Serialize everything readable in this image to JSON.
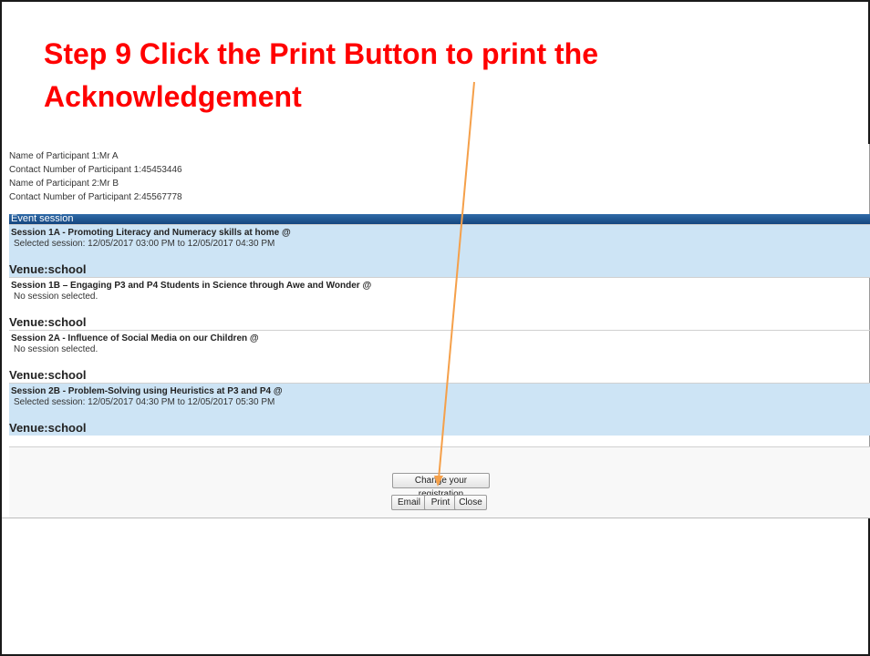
{
  "slide": {
    "title_line1": "Step 9 Click the Print Button to print the",
    "title_line2": "Acknowledgement"
  },
  "participants": [
    "Name of Participant 1:Mr A",
    "Contact Number of Participant 1:45453446",
    "Name of Participant 2:Mr B",
    "Contact Number of Participant 2:45567778"
  ],
  "event_session_header": "Event session",
  "sessions": [
    {
      "title": "Session 1A - Promoting Literacy and Numeracy skills at home @",
      "status": "Selected session: 12/05/2017 03:00 PM to 12/05/2017 04:30 PM",
      "venue": "Venue:school",
      "selected": true
    },
    {
      "title": "Session 1B – Engaging P3 and P4 Students in Science through Awe and Wonder @",
      "status": "No session selected.",
      "venue": "Venue:school",
      "selected": false
    },
    {
      "title": "Session 2A - Influence of Social Media on our Children @",
      "status": "No session selected.",
      "venue": "Venue:school",
      "selected": false
    },
    {
      "title": "Session 2B - Problem-Solving using Heuristics at P3 and P4 @",
      "status": "Selected session: 12/05/2017 04:30 PM to 12/05/2017 05:30 PM",
      "venue": "Venue:school",
      "selected": true
    }
  ],
  "buttons": {
    "change": "Change your registration",
    "email": "Email",
    "print": "Print",
    "close": "Close"
  },
  "colors": {
    "title": "#ff0000",
    "header_bar": "#1f5793",
    "selected_row": "#cde4f5",
    "arrow": "#f5a04a"
  }
}
